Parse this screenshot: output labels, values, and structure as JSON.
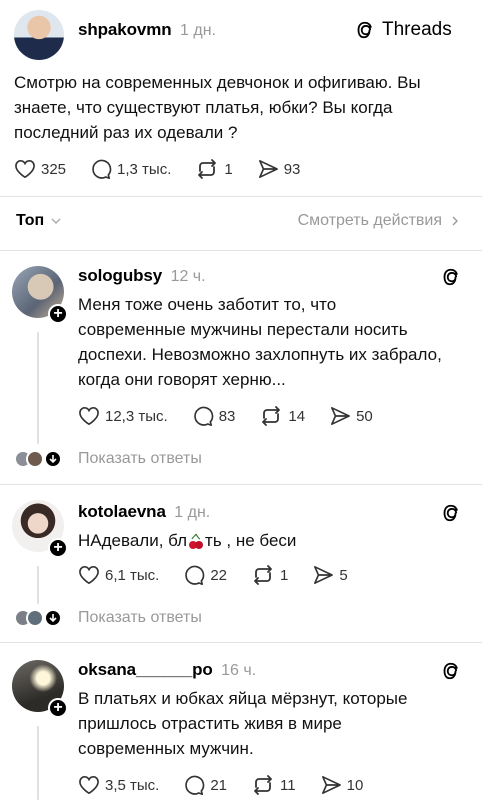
{
  "post": {
    "username": "shpakovmn",
    "time": "1 дн.",
    "brand": "Threads",
    "text": "Смотрю на современных девчонок и офигиваю. Вы знаете, что существуют платья, юбки? Вы когда последний раз их одевали ?",
    "likes": "325",
    "comments": "1,3 тыс.",
    "reposts": "1",
    "shares": "93"
  },
  "filter": {
    "sort_label": "Топ",
    "activity_label": "Смотреть действия"
  },
  "replies": [
    {
      "username": "sologubsy",
      "time": "12 ч.",
      "text": "Меня тоже очень заботит то, что современные мужчины перестали носить доспехи. Невозможно захлопнуть их забрало, когда они говорят херню...",
      "likes": "12,3 тыс.",
      "comments": "83",
      "reposts": "14",
      "shares": "50",
      "show_replies": "Показать ответы"
    },
    {
      "username": "kotolaevna",
      "time": "1 дн.",
      "text_before": "НАдевали, бл",
      "text_after": "ть , не беси",
      "likes": "6,1 тыс.",
      "comments": "22",
      "reposts": "1",
      "shares": "5",
      "show_replies": "Показать ответы"
    },
    {
      "username": "oksana______po",
      "time": "16 ч.",
      "text": "В платьях и юбках яйца мёрзнут, которые пришлось отрастить живя в мире современных мужчин.",
      "likes": "3,5 тыс.",
      "comments": "21",
      "reposts": "11",
      "shares": "10"
    }
  ],
  "icons": {
    "like": "heart-icon",
    "comment": "comment-icon",
    "repost": "repost-icon",
    "share": "share-icon",
    "threads": "threads-logo-icon",
    "chevron": "chevron-down-icon",
    "chevron_right": "chevron-right-icon",
    "follow": "plus-icon"
  },
  "colors": {
    "text": "#000000",
    "muted": "#999999",
    "divider": "#e3e3e3"
  }
}
